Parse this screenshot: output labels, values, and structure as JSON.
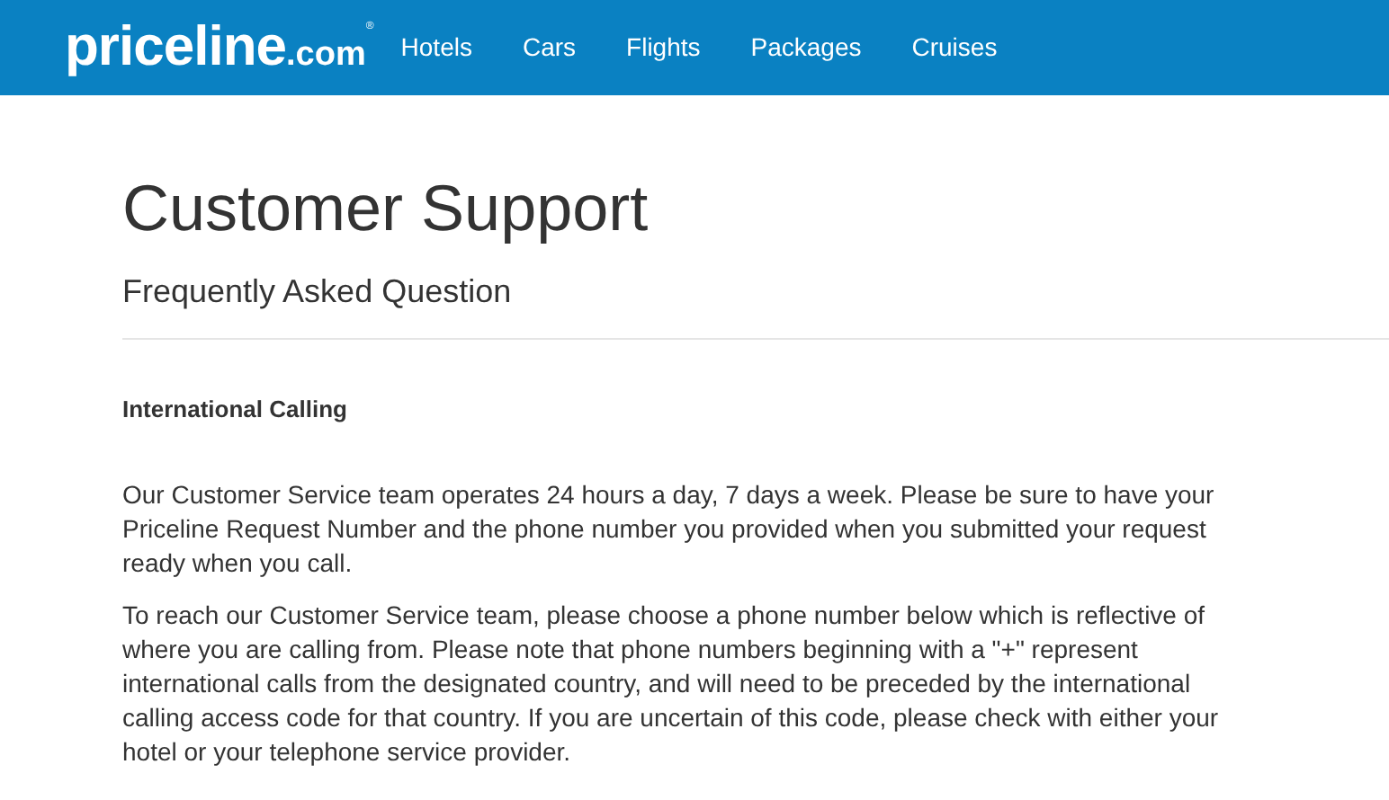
{
  "header": {
    "logo": {
      "name": "priceline",
      "suffix": ".com",
      "mark": "®"
    },
    "nav": [
      {
        "label": "Hotels"
      },
      {
        "label": "Cars"
      },
      {
        "label": "Flights"
      },
      {
        "label": "Packages"
      },
      {
        "label": "Cruises"
      }
    ]
  },
  "page": {
    "title": "Customer Support",
    "subtitle": "Frequently Asked Question",
    "section_title": "International Calling",
    "paragraphs": [
      "Our Customer Service team operates 24 hours a day, 7 days a week. Please be sure to have your Priceline Request Number and the phone number you provided when you submitted your request ready when you call.",
      "To reach our Customer Service team, please choose a phone number below which is reflective of where you are calling from. Please note that phone numbers beginning with a \"+\" represent international calls from the designated country, and will need to be preceded by the international calling access code for that country. If you are uncertain of this code, please check with either your hotel or your telephone service provider."
    ]
  }
}
